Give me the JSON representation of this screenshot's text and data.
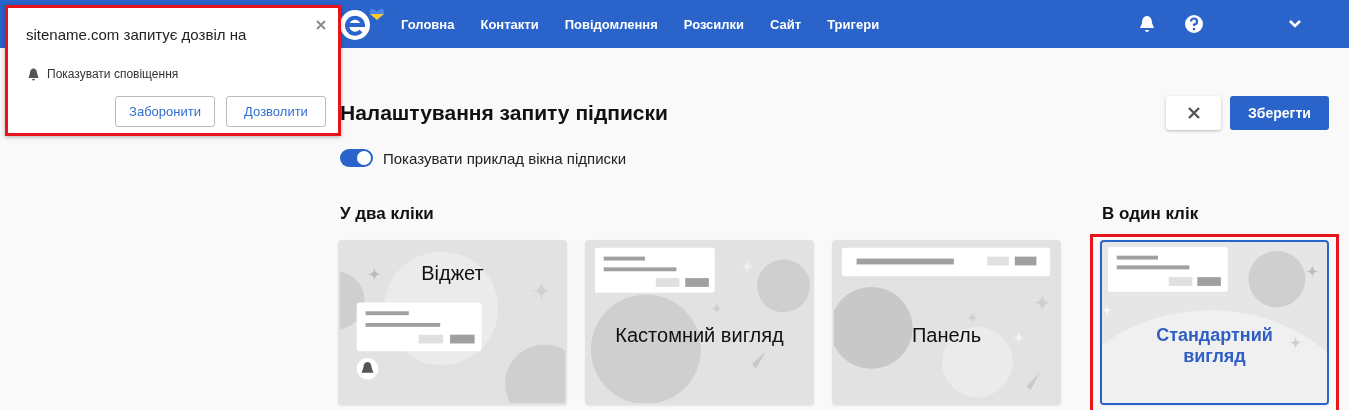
{
  "popup": {
    "message": "sitename.com запитує дозвіл на",
    "permission": "Показувати сповіщення",
    "buttons": [
      "Заборонити",
      "Дозволити"
    ],
    "highlighted": true
  },
  "nav": {
    "items": [
      "Головна",
      "Контакти",
      "Повідомлення",
      "Розсилки",
      "Сайт",
      "Тригери"
    ]
  },
  "page": {
    "title": "Налаштування запиту підписки",
    "save_button": "Зберегти",
    "toggle": {
      "label": "Показувати приклад вікна підписки",
      "on": true
    }
  },
  "groups": [
    {
      "title": "У два кліки",
      "cards": [
        {
          "label": "Віджет",
          "kind": "widget",
          "selected": false,
          "highlighted": false
        },
        {
          "label": "Кастомний вигляд",
          "kind": "custom",
          "selected": false,
          "highlighted": false
        },
        {
          "label": "Панель",
          "kind": "panel",
          "selected": false,
          "highlighted": false
        }
      ]
    },
    {
      "title": "В один клік",
      "cards": [
        {
          "label": "Стандартний вигляд",
          "kind": "standard",
          "selected": true,
          "highlighted": true
        }
      ]
    }
  ]
}
